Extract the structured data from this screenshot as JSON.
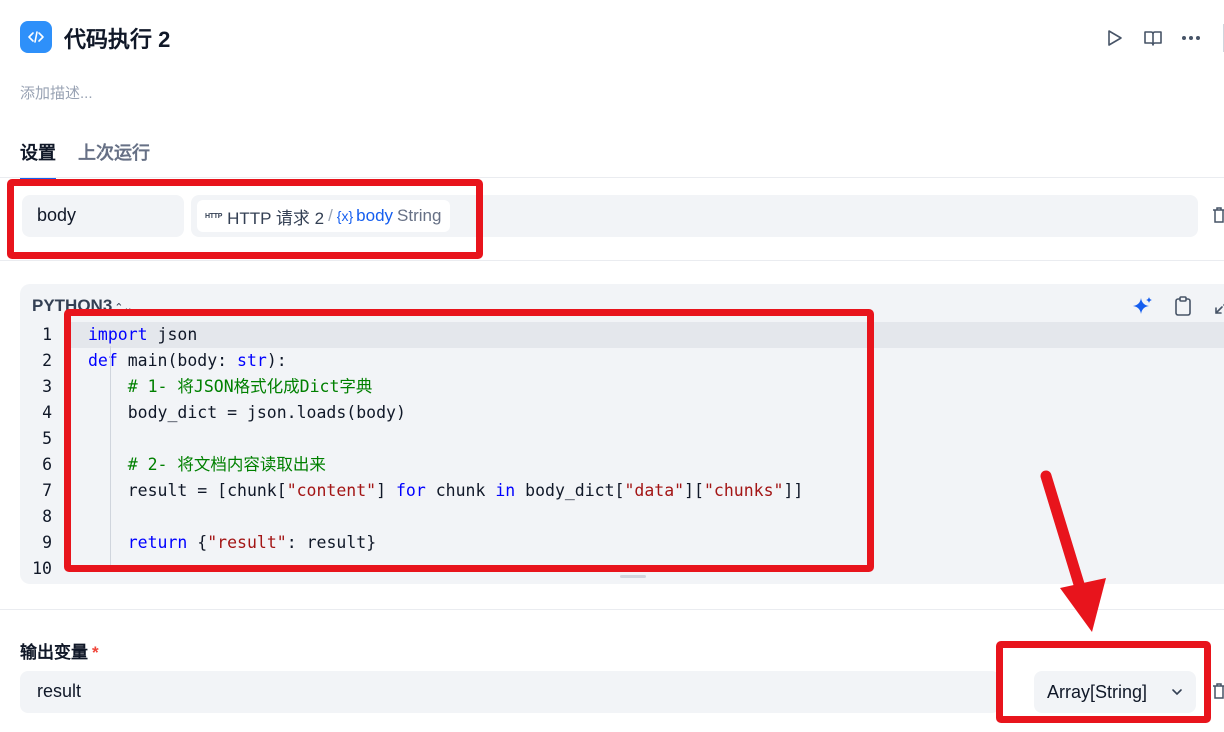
{
  "header": {
    "title": "代码执行 2",
    "description_placeholder": "添加描述..."
  },
  "tabs": [
    {
      "label": "设置",
      "active": true
    },
    {
      "label": "上次运行",
      "active": false
    }
  ],
  "input_variable": {
    "name": "body",
    "ref_node_icon": "HTTP",
    "ref_node": "HTTP 请求 2",
    "ref_sep": "/",
    "ref_var_icon": "{x}",
    "ref_var": "body",
    "ref_type": "String"
  },
  "code_editor": {
    "language": "PYTHON3",
    "lang_arrow": "⌃⌄"
  },
  "output": {
    "label": "输出变量",
    "required_mark": "*",
    "variable_name": "result",
    "variable_type": "Array[String]"
  },
  "colors": {
    "accent": "#155eef",
    "app_icon": "#2e90fa",
    "annotation_red": "#e8141c"
  }
}
